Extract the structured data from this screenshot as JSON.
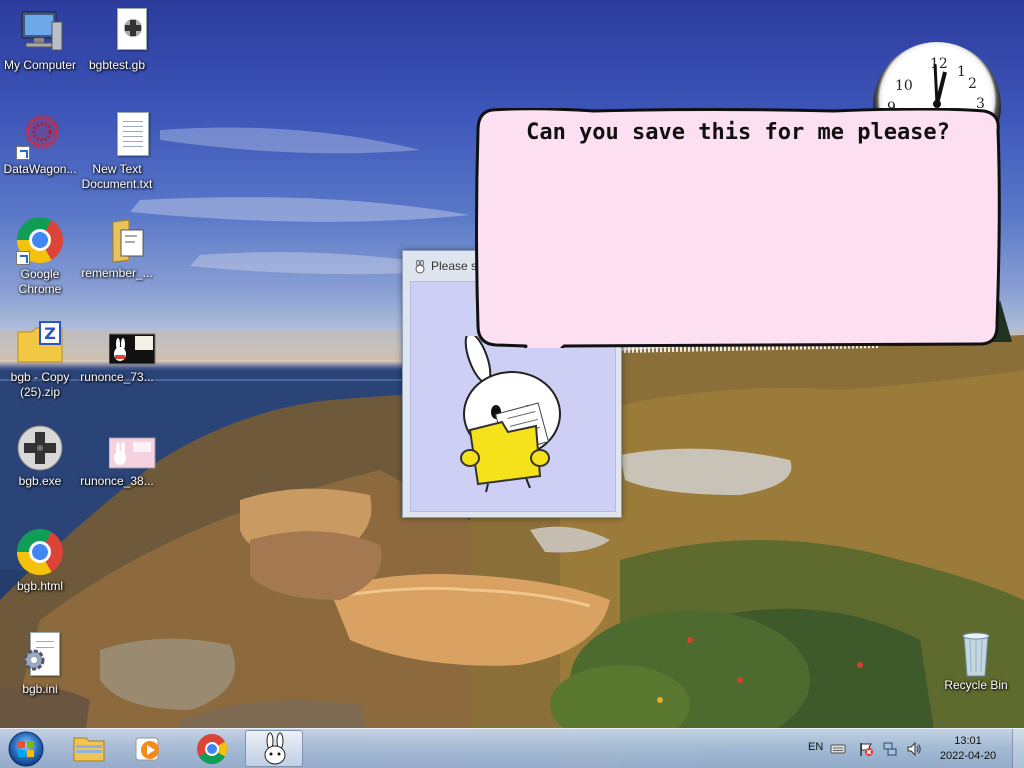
{
  "desktop": {
    "icons": [
      {
        "label": "My Computer",
        "icon": "computer-icon"
      },
      {
        "label": "bgbtest.gb",
        "icon": "gb-file-icon"
      },
      {
        "label": "DataWagon...",
        "icon": "datawagon-shortcut-icon"
      },
      {
        "label": "New Text Document.txt",
        "icon": "text-document-icon"
      },
      {
        "label": "Google Chrome",
        "icon": "chrome-shortcut-icon"
      },
      {
        "label": "remember_...",
        "icon": "folder-file-icon"
      },
      {
        "label": "bgb - Copy (25).zip",
        "icon": "zip-folder-icon"
      },
      {
        "label": "runonce_73...",
        "icon": "image-thumbnail-icon"
      },
      {
        "label": "bgb.exe",
        "icon": "gamepad-exe-icon"
      },
      {
        "label": "runonce_38...",
        "icon": "image-thumbnail-icon"
      },
      {
        "label": "bgb.html",
        "icon": "chrome-html-icon"
      },
      {
        "label": "bgb.ini",
        "icon": "settings-file-icon"
      }
    ],
    "recycle_bin": {
      "label": "Recycle Bin",
      "icon": "recycle-bin-icon"
    }
  },
  "clock_gadget": {
    "numerals": [
      "12",
      "1",
      "2",
      "3",
      "10",
      "9"
    ],
    "icon": "analog-clock-gadget"
  },
  "dialog": {
    "title": "Please sa",
    "icon": "bunny-app-icon"
  },
  "bubble": {
    "text": "Can you save this for me please?"
  },
  "taskbar": {
    "start_icon": "windows-start-orb",
    "pinned": [
      "file-explorer-icon",
      "media-player-icon",
      "chrome-icon",
      "bunny-app-icon"
    ],
    "tray": {
      "language": "EN",
      "icons": [
        "keyboard-icon",
        "action-center-flag-icon",
        "network-icon",
        "volume-icon"
      ],
      "time": "13:01",
      "date": "2022-04-20"
    }
  }
}
